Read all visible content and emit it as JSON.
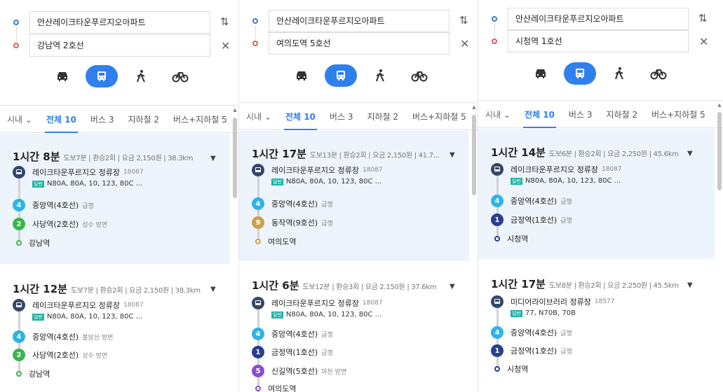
{
  "panels": [
    {
      "origin": "안산레이크타운푸르지오아파트",
      "destination": "강남역 2호선",
      "tabs": [
        "시내 ⌄",
        "전체 10",
        "버스 3",
        "지하철 2",
        "버스+지하철 5"
      ],
      "routes": [
        {
          "time": "1시간 8분",
          "meta": "도보7분 | 환승2회 | 요금 2,150원 | 38.3km",
          "bus_stop": "레이크타운푸르지오 정류장",
          "bus_stop_id": "18087",
          "bus_tag": "일반",
          "bus_lines": "N80A, 80A, 10, 123, 80C ...",
          "steps": [
            {
              "label": "4",
              "color": "#2fb3e6",
              "name": "중앙역(4호선)",
              "note": "급행"
            },
            {
              "label": "2",
              "color": "#3ab54a",
              "name": "사당역(2호선)",
              "note": "성수 방면"
            }
          ],
          "end": {
            "name": "강남역",
            "color": "#3ab54a"
          }
        },
        {
          "time": "1시간 12분",
          "meta": "도보7분 | 환승2회 | 요금 2,150원 | 38.3km",
          "bus_stop": "레이크타운푸르지오 정류장",
          "bus_stop_id": "18087",
          "bus_tag": "일반",
          "bus_lines": "N80A, 80A, 10, 123, 80C ...",
          "steps": [
            {
              "label": "4",
              "color": "#2fb3e6",
              "name": "중앙역(4호선)",
              "note": "불암산 방면"
            },
            {
              "label": "2",
              "color": "#3ab54a",
              "name": "사당역(2호선)",
              "note": "성수 방면"
            }
          ],
          "end": {
            "name": "강남역",
            "color": "#3ab54a"
          }
        }
      ]
    },
    {
      "origin": "안산레이크타운푸르지오아파트",
      "destination": "여의도역 5호선",
      "tabs": [
        "시내 ⌄",
        "전체 10",
        "버스 3",
        "지하철 2",
        "버스+지하철 5"
      ],
      "routes": [
        {
          "time": "1시간 17분",
          "meta": "도보13분 | 환승2회 | 요금 2,150원 | 41.7...",
          "bus_stop": "레이크타운푸르지오 정류장",
          "bus_stop_id": "18087",
          "bus_tag": "일반",
          "bus_lines": "N80A, 80A, 10, 123, 80C ...",
          "steps": [
            {
              "label": "4",
              "color": "#2fb3e6",
              "name": "중앙역(4호선)",
              "note": "급행"
            },
            {
              "label": "9",
              "color": "#c9a24a",
              "name": "동작역(9호선)",
              "note": "급행"
            }
          ],
          "end": {
            "name": "여의도역",
            "color": "#c9a24a"
          }
        },
        {
          "time": "1시간 6분",
          "meta": "도보12분 | 환승3회 | 요금 2,150원 | 37.6km",
          "bus_stop": "레이크타운푸르지오 정류장",
          "bus_stop_id": "18087",
          "bus_tag": "일반",
          "bus_lines": "N80A, 80A, 10, 123, 80C ...",
          "steps": [
            {
              "label": "4",
              "color": "#2fb3e6",
              "name": "중앙역(4호선)",
              "note": "급행"
            },
            {
              "label": "1",
              "color": "#283f8e",
              "name": "금정역(1호선)",
              "note": "급행"
            },
            {
              "label": "5",
              "color": "#8e4bd0",
              "name": "신길역(5호선)",
              "note": "마천 방면"
            }
          ],
          "end": {
            "name": "여의도역",
            "color": "#8e4bd0"
          }
        }
      ]
    },
    {
      "origin": "안산레이크타운푸르지오아파트",
      "destination": "시청역 1호선",
      "tabs": [
        "시내 ⌄",
        "전체 10",
        "버스 3",
        "지하철 2",
        "버스+지하철 5"
      ],
      "routes": [
        {
          "time": "1시간 14분",
          "meta": "도보6분 | 환승2회 | 요금 2,250원 | 45.6km",
          "bus_stop": "레이크타운푸르지오 정류장",
          "bus_stop_id": "18087",
          "bus_tag": "일반",
          "bus_lines": "N80A, 80A, 10, 123, 80C ...",
          "steps": [
            {
              "label": "4",
              "color": "#2fb3e6",
              "name": "중앙역(4호선)",
              "note": "급행"
            },
            {
              "label": "1",
              "color": "#283f8e",
              "name": "금정역(1호선)",
              "note": "급행"
            }
          ],
          "end": {
            "name": "시청역",
            "color": "#283f8e"
          }
        },
        {
          "time": "1시간 17분",
          "meta": "도보8분 | 환승2회 | 요금 2,250원 | 45.5km",
          "bus_stop": "미디어라이브러리 정류장",
          "bus_stop_id": "18577",
          "bus_tag": "일반",
          "bus_lines": "77, N70B, 70B",
          "steps": [
            {
              "label": "4",
              "color": "#2fb3e6",
              "name": "중앙역(4호선)",
              "note": "급행"
            },
            {
              "label": "1",
              "color": "#283f8e",
              "name": "금정역(1호선)",
              "note": "급행"
            }
          ],
          "end": {
            "name": "시청역",
            "color": "#283f8e"
          }
        }
      ]
    }
  ]
}
